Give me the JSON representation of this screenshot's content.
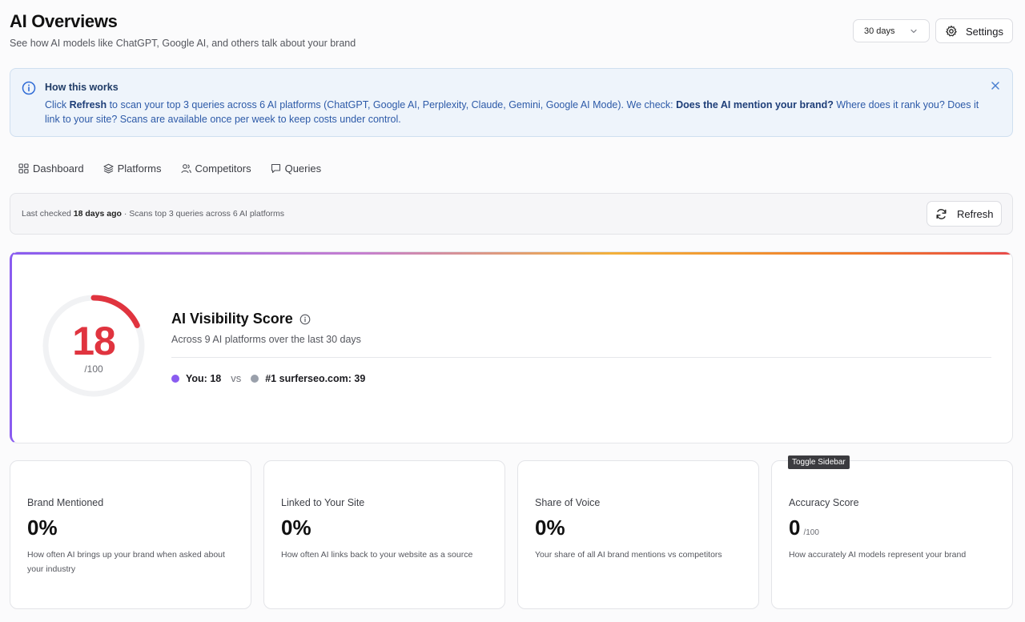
{
  "header": {
    "title": "AI Overviews",
    "subtitle": "See how AI models like ChatGPT, Google AI, and others talk about your brand",
    "range_value": "30 days",
    "settings_label": "Settings"
  },
  "info": {
    "title": "How this works",
    "body_1": "Click ",
    "body_bold_1": "Refresh",
    "body_2": " to scan your top 3 queries across 6 AI platforms (ChatGPT, Google AI, Perplexity, Claude, Gemini, Google AI Mode). We check: ",
    "body_bold_2": "Does the AI mention your brand?",
    "body_3": " Where does it rank you? Does it link to your site? Scans are available once per week to keep costs under control."
  },
  "tabs": [
    {
      "label": "Dashboard",
      "icon": "grid-icon"
    },
    {
      "label": "Platforms",
      "icon": "layers-icon"
    },
    {
      "label": "Competitors",
      "icon": "users-icon"
    },
    {
      "label": "Queries",
      "icon": "message-icon"
    }
  ],
  "check": {
    "prefix": "Last checked ",
    "age": "18 days ago",
    "suffix": " · Scans top 3 queries across 6 AI platforms",
    "refresh_label": "Refresh"
  },
  "score": {
    "value": "18",
    "max": "/100",
    "fraction": 0.18,
    "title": "AI Visibility Score",
    "subtitle": "Across 9 AI platforms over the last 30 days",
    "you_label": "You: 18",
    "vs": "vs",
    "competitor_label": "#1 surferseo.com: 39",
    "you_color": "#8a5cf0",
    "competitor_color": "#9aa0ab",
    "score_color": "#e0343f"
  },
  "metrics": [
    {
      "label": "Brand Mentioned",
      "value": "0%",
      "unit": "",
      "desc": "How often AI brings up your brand when asked about your industry"
    },
    {
      "label": "Linked to Your Site",
      "value": "0%",
      "unit": "",
      "desc": "How often AI links back to your website as a source"
    },
    {
      "label": "Share of Voice",
      "value": "0%",
      "unit": "",
      "desc": "Your share of all AI brand mentions vs competitors"
    },
    {
      "label": "Accuracy Score",
      "value": "0",
      "unit": "/100",
      "desc": "How accurately AI models represent your brand"
    }
  ],
  "tooltip": "Toggle Sidebar"
}
